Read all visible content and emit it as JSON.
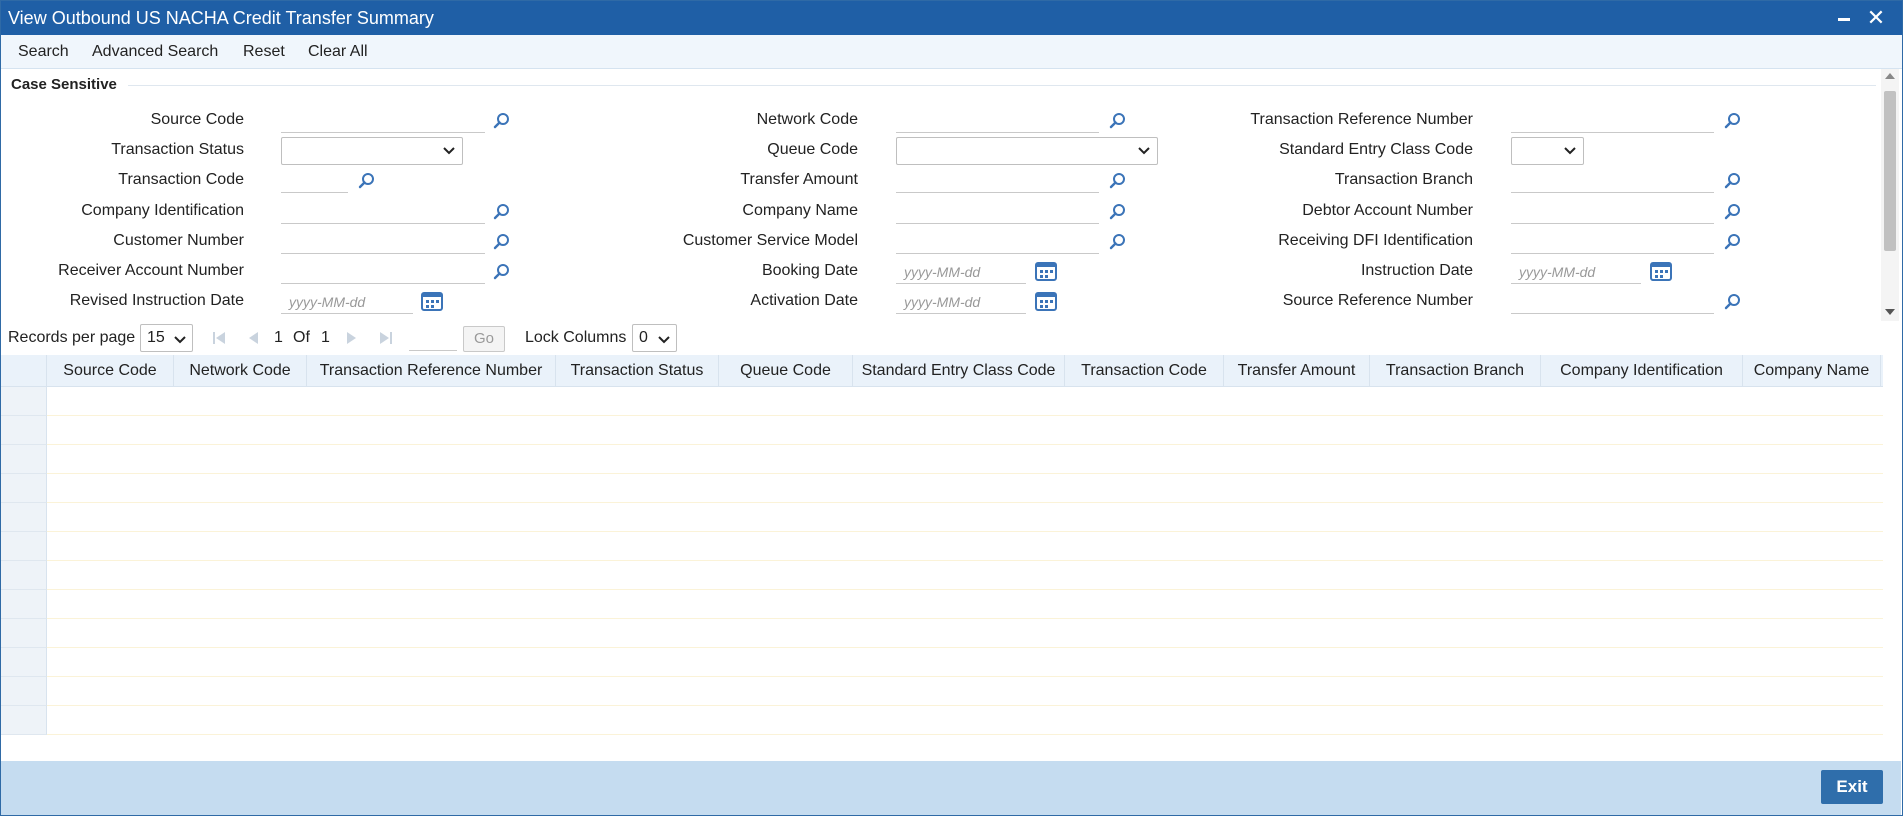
{
  "window": {
    "title": "View Outbound US NACHA Credit Transfer Summary"
  },
  "toolbar": {
    "search": "Search",
    "advanced_search": "Advanced Search",
    "reset": "Reset",
    "clear_all": "Clear All"
  },
  "panel": {
    "legend": "Case Sensitive",
    "fields": {
      "source_code": "Source Code",
      "network_code": "Network Code",
      "transaction_reference_number": "Transaction Reference Number",
      "transaction_status": "Transaction Status",
      "queue_code": "Queue Code",
      "standard_entry_class_code": "Standard Entry Class Code",
      "transaction_code": "Transaction Code",
      "transfer_amount": "Transfer Amount",
      "transaction_branch": "Transaction Branch",
      "company_identification": "Company Identification",
      "company_name": "Company Name",
      "debtor_account_number": "Debtor Account Number",
      "customer_number": "Customer Number",
      "customer_service_model": "Customer Service Model",
      "receiving_dfi_identification": "Receiving DFI Identification",
      "receiver_account_number": "Receiver Account Number",
      "booking_date": "Booking Date",
      "instruction_date": "Instruction Date",
      "revised_instruction_date": "Revised Instruction Date",
      "activation_date": "Activation Date",
      "source_reference_number": "Source Reference Number"
    },
    "date_placeholder": "yyyy-MM-dd"
  },
  "pager": {
    "records_per_page_label": "Records per page",
    "records_per_page_value": "15",
    "current_page": "1",
    "of_label": "Of",
    "total_pages": "1",
    "go_label": "Go",
    "lock_columns_label": "Lock Columns",
    "lock_columns_value": "0"
  },
  "grid": {
    "columns": [
      "Source Code",
      "Network Code",
      "Transaction Reference Number",
      "Transaction Status",
      "Queue Code",
      "Standard Entry Class Code",
      "Transaction Code",
      "Transfer Amount",
      "Transaction Branch",
      "Company Identification",
      "Company Name"
    ],
    "row_count": 12
  },
  "footer": {
    "exit": "Exit"
  },
  "colors": {
    "titlebar": "#1f5fa6",
    "accent": "#2f6eab",
    "icon_blue": "#3b74b8",
    "footer": "#c5dcf0"
  }
}
